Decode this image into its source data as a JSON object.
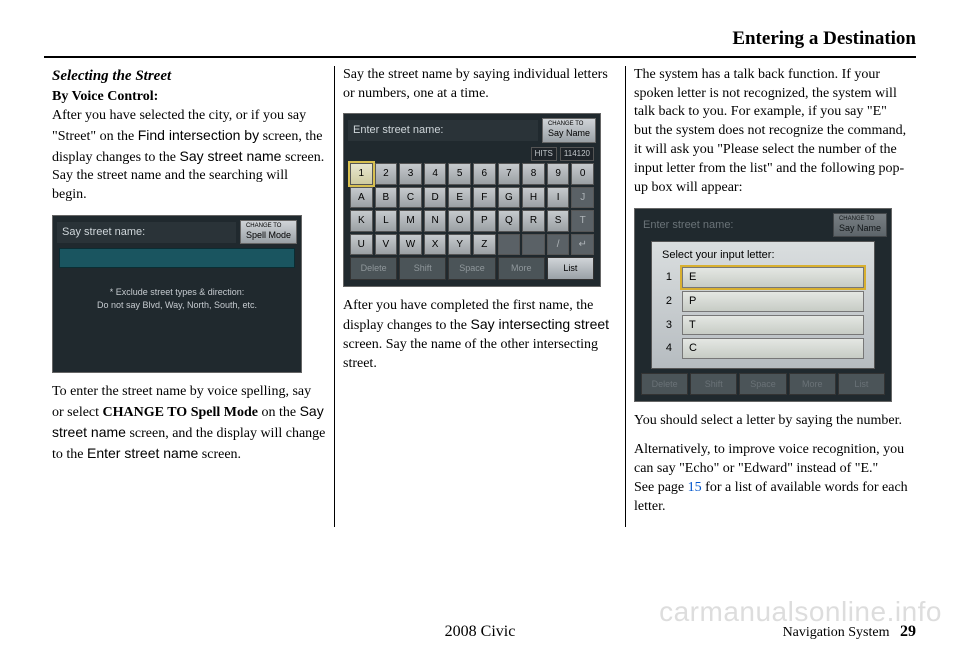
{
  "header": {
    "title": "Entering a Destination"
  },
  "col1": {
    "subhead": "Selecting the Street",
    "byline": "By Voice Control:",
    "p1a": "After you have selected the city, or if you say \"Street\" on the ",
    "p1b": "Find intersection by",
    "p1c": " screen, the display changes to the ",
    "p1d": "Say street name",
    "p1e": " screen. Say the street name and the searching will begin.",
    "fig": {
      "title": "Say street name:",
      "btn_small": "CHANGE TO",
      "btn": "Spell Mode",
      "note1": "* Exclude street types & direction:",
      "note2": "Do not say Blvd, Way, North, South, etc."
    },
    "p2a": "To enter the street name by voice spelling, say or select ",
    "p2b": "CHANGE TO Spell Mode",
    "p2c": " on the ",
    "p2d": "Say street name",
    "p2e": " screen, and the display will change to the ",
    "p2f": "Enter street name",
    "p2g": " screen."
  },
  "col2": {
    "p1": "Say the street name by saying individual letters or numbers, one at a time.",
    "fig": {
      "title": "Enter street name:",
      "btn_small": "CHANGE TO",
      "btn": "Say Name",
      "hits_label": "HITS",
      "hits_value": "114120",
      "row1": [
        "1",
        "2",
        "3",
        "4",
        "5",
        "6",
        "7",
        "8",
        "9",
        "0"
      ],
      "row2": [
        "A",
        "B",
        "C",
        "D",
        "E",
        "F",
        "G",
        "H",
        "I",
        "J"
      ],
      "row3": [
        "K",
        "L",
        "M",
        "N",
        "O",
        "P",
        "Q",
        "R",
        "S",
        "T"
      ],
      "row4": [
        "U",
        "V",
        "W",
        "X",
        "Y",
        "Z",
        "",
        "",
        "/",
        "↵"
      ],
      "fn": [
        "Delete",
        "Shift",
        "Space",
        "More",
        "List"
      ]
    },
    "p2a": "After you have completed the first name, the display changes to the ",
    "p2b": "Say intersecting street",
    "p2c": " screen. Say the name of the other intersecting street."
  },
  "col3": {
    "p1": "The system has a talk back function. If your spoken letter is not recognized, the system will talk back to you. For example, if you say \"E\" but the system does not recognize the command, it will ask you \"Please select the number of the input letter from the list\" and the following pop-up box will appear:",
    "fig": {
      "bgtitle": "Enter street name:",
      "btn_small": "CHANGE TO",
      "btn": "Say Name",
      "popup_title": "Select your input letter:",
      "options": [
        {
          "n": "1",
          "v": "E"
        },
        {
          "n": "2",
          "v": "P"
        },
        {
          "n": "3",
          "v": "T"
        },
        {
          "n": "4",
          "v": "C"
        }
      ],
      "fn": [
        "Delete",
        "Shift",
        "Space",
        "More",
        "List"
      ]
    },
    "p2": "You should select a letter by saying the number.",
    "p3a": "Alternatively, to improve voice recognition, you can say \"Echo\" or \"Edward\" instead of \"E.\"",
    "p3b": "See page ",
    "p3c": "15",
    "p3d": " for a list of available words for each letter."
  },
  "footer": {
    "center": "2008   Civic",
    "label": "Navigation System",
    "page": "29"
  },
  "watermark": "carmanualsonline.info"
}
